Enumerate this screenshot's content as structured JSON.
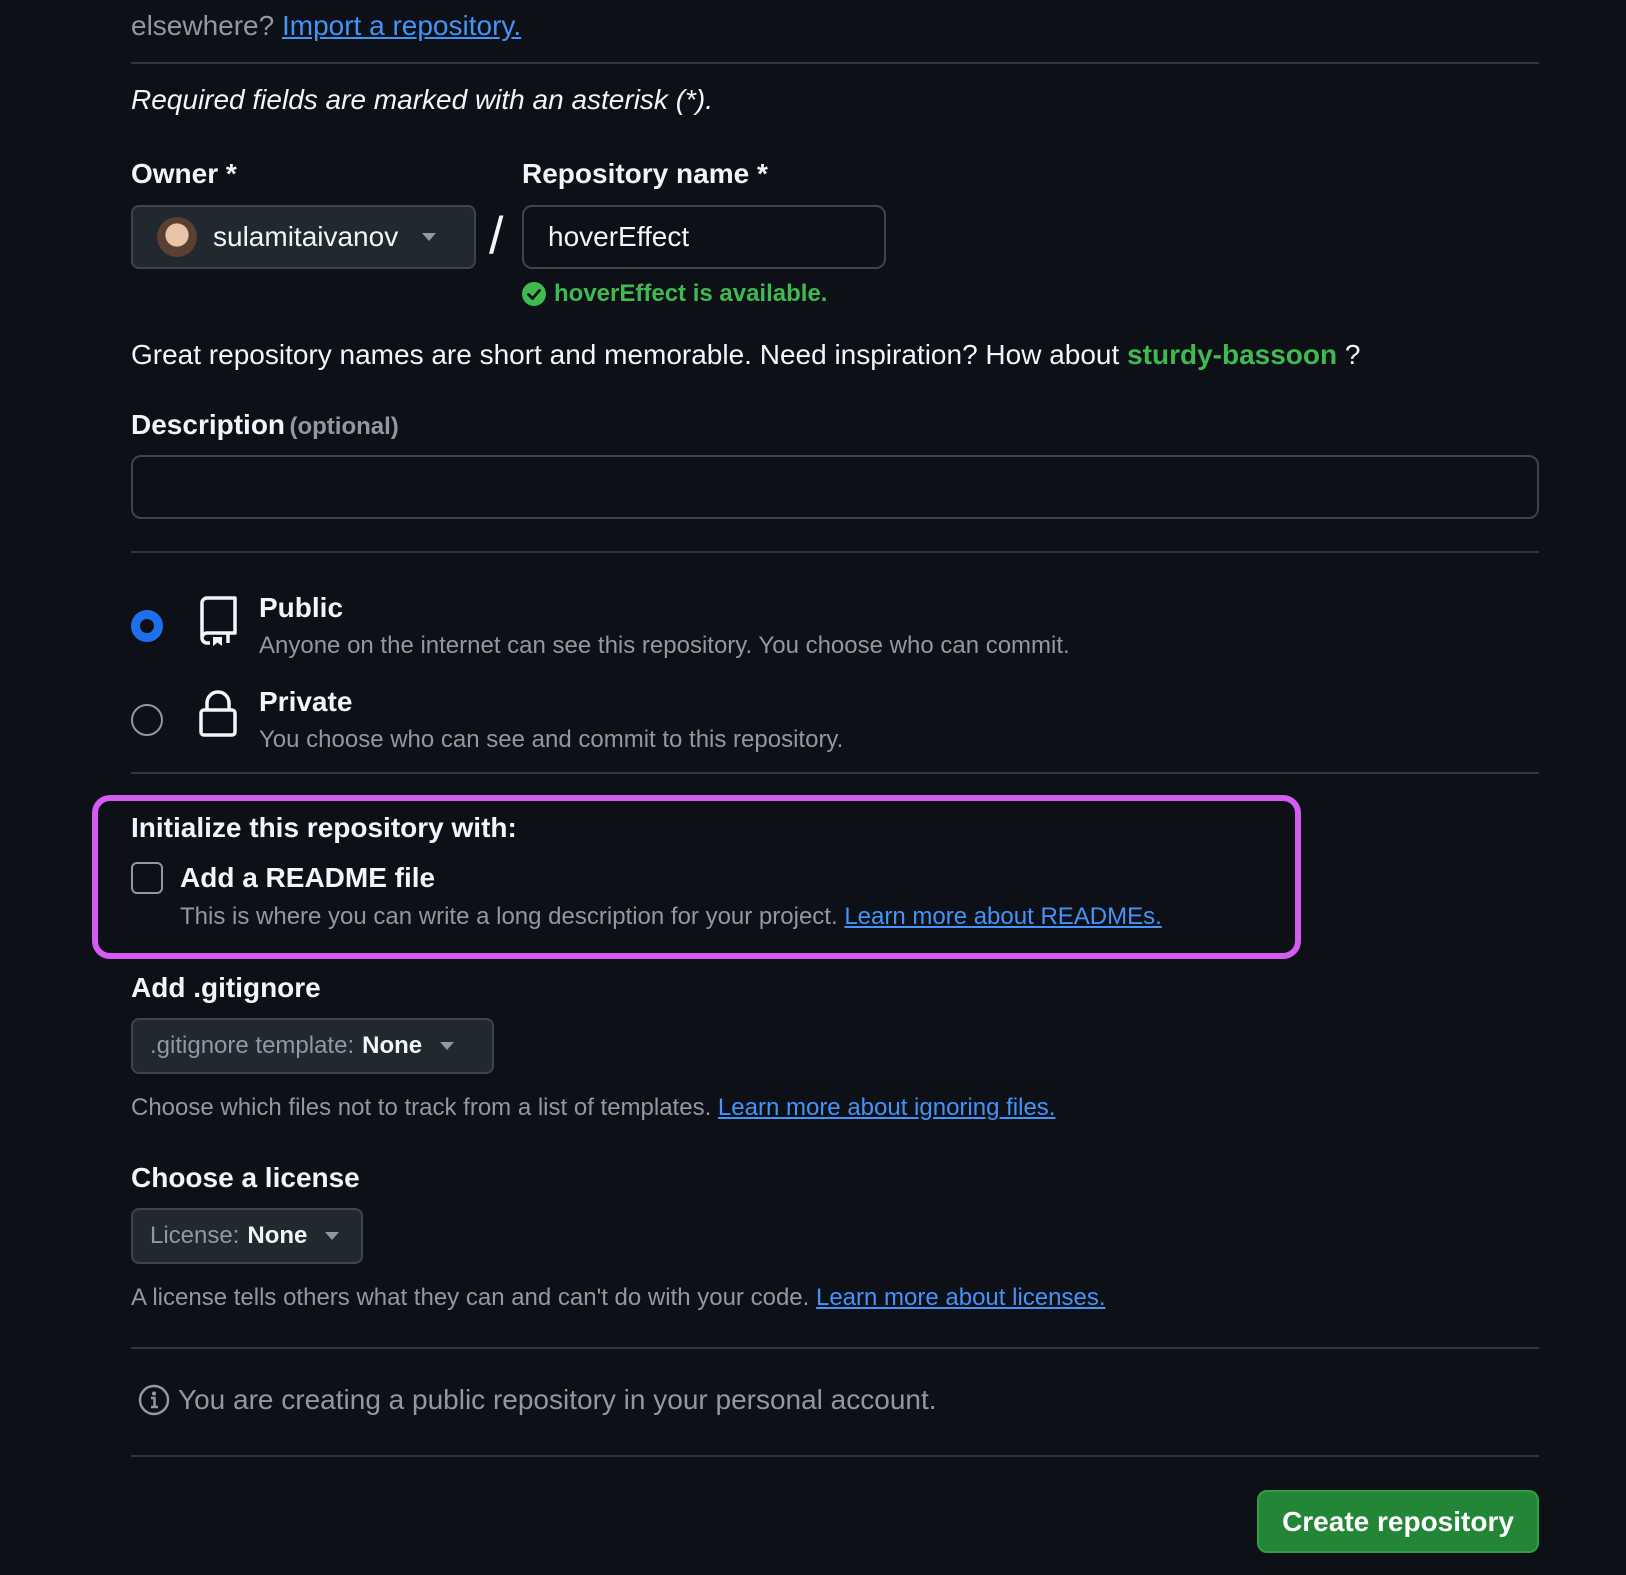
{
  "import": {
    "prefix": "elsewhere?",
    "link": "Import a repository."
  },
  "required_note": "Required fields are marked with an asterisk (*).",
  "owner": {
    "label": "Owner *",
    "value": "sulamitaivanov"
  },
  "separator": "/",
  "repo_name": {
    "label": "Repository name *",
    "value": "hoverEffect",
    "availability": "hoverEffect is available."
  },
  "suggestion": {
    "text": "Great repository names are short and memorable. Need inspiration? How about",
    "name": "sturdy-bassoon",
    "suffix": "?"
  },
  "description": {
    "label": "Description",
    "optional": "(optional)",
    "value": ""
  },
  "visibility": {
    "selected": "public",
    "public": {
      "title": "Public",
      "desc": "Anyone on the internet can see this repository. You choose who can commit."
    },
    "private": {
      "title": "Private",
      "desc": "You choose who can see and commit to this repository."
    }
  },
  "initialize": {
    "heading": "Initialize this repository with:",
    "readme_label": "Add a README file",
    "readme_checked": false,
    "readme_desc": "This is where you can write a long description for your project.",
    "readme_link": "Learn more about READMEs."
  },
  "gitignore": {
    "label": "Add .gitignore",
    "select_prefix": ".gitignore template:",
    "select_value": "None",
    "help": "Choose which files not to track from a list of templates.",
    "help_link": "Learn more about ignoring files."
  },
  "license": {
    "label": "Choose a license",
    "select_prefix": "License:",
    "select_value": "None",
    "help": "A license tells others what they can and can't do with your code.",
    "help_link": "Learn more about licenses."
  },
  "info_note": "You are creating a public repository in your personal account.",
  "create_button": "Create repository",
  "colors": {
    "background": "#0d1117",
    "link": "#4493f8",
    "success": "#3fb950",
    "radio_selected": "#1f6feb",
    "highlight": "#d55cf2",
    "button": "#238636"
  },
  "icons": [
    "avatar",
    "chevron-down-icon",
    "check-circle-icon",
    "repo-icon",
    "lock-icon",
    "info-icon"
  ]
}
